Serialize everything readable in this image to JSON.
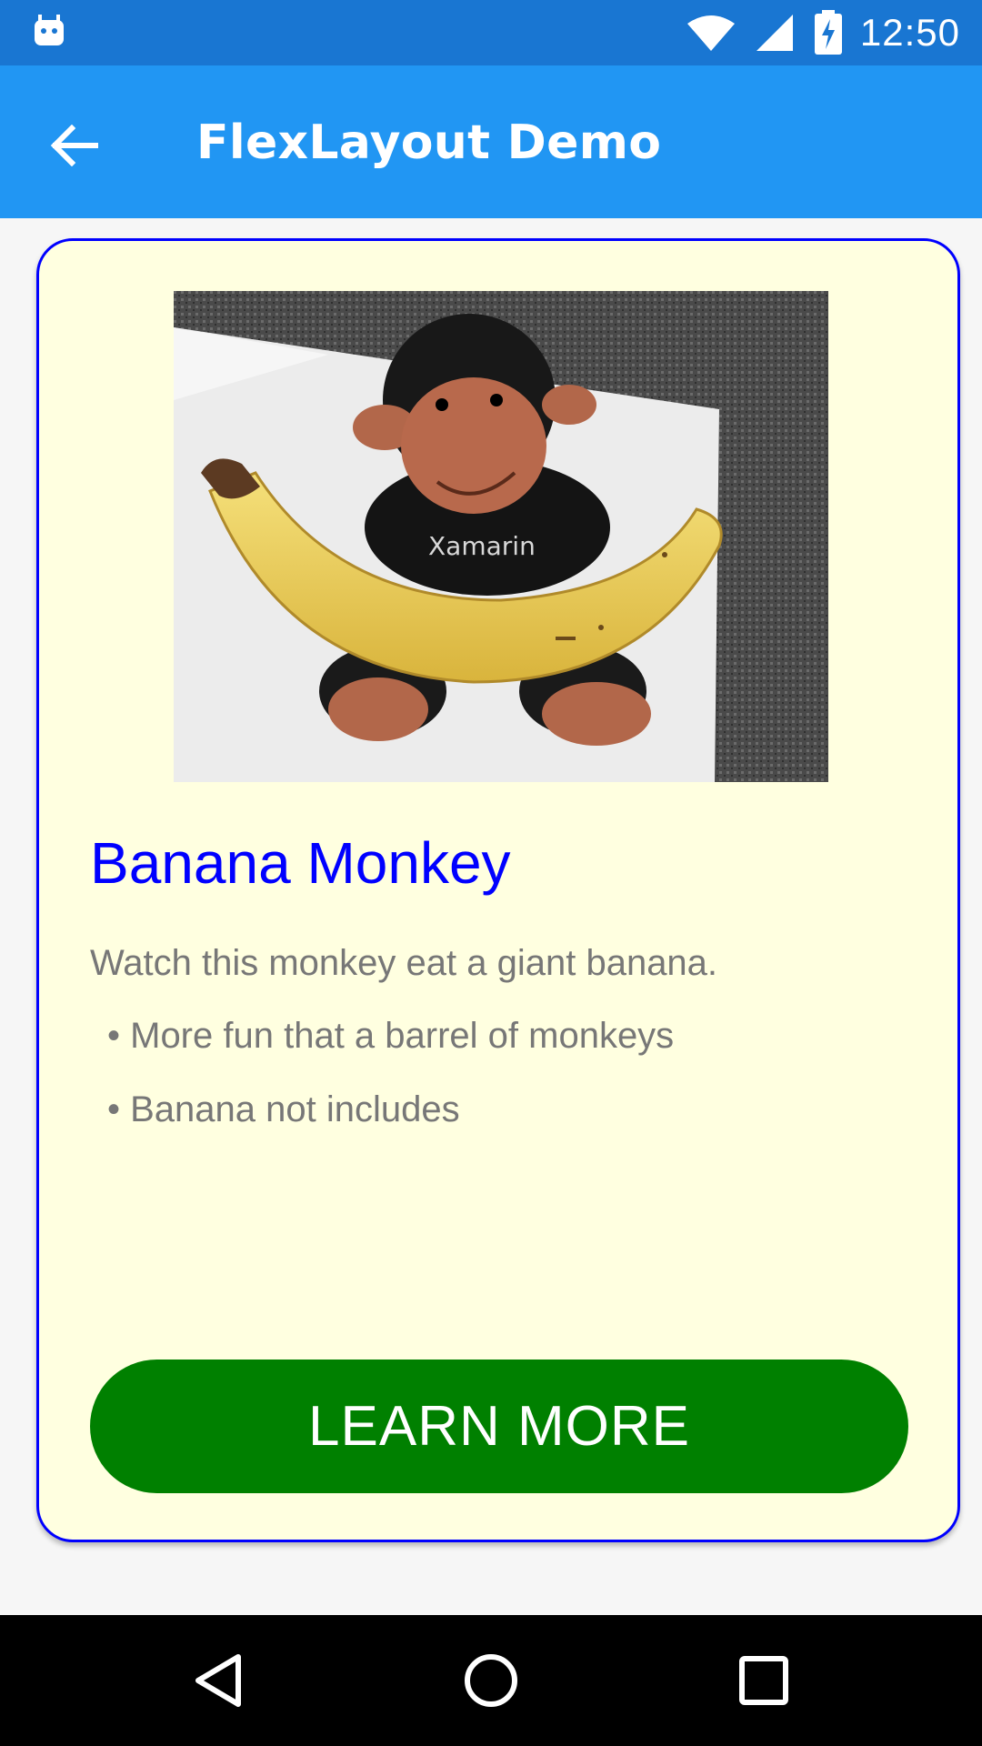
{
  "status_bar": {
    "time": "12:50",
    "left_icon": "android-debug-icon",
    "icons": [
      "wifi-icon",
      "signal-icon",
      "battery-charging-icon"
    ]
  },
  "app_bar": {
    "title": "FlexLayout Demo",
    "back_icon": "arrow-back-icon"
  },
  "card": {
    "image_caption_text": "Xamarin",
    "title": "Banana Monkey",
    "description": "Watch this monkey eat a giant banana.",
    "bullets": [
      "• More fun that a barrel of monkeys",
      "• Banana not includes"
    ],
    "button_label": "LEARN MORE"
  },
  "nav_bar": {
    "icons": [
      "nav-back-icon",
      "nav-home-icon",
      "nav-recents-icon"
    ]
  },
  "colors": {
    "status_bar": "#1976d2",
    "app_bar": "#2196f3",
    "card_background": "#ffffe0",
    "card_border": "#0000ff",
    "title": "#0000ff",
    "text": "#777777",
    "button": "#008000",
    "nav_bar": "#000000"
  }
}
